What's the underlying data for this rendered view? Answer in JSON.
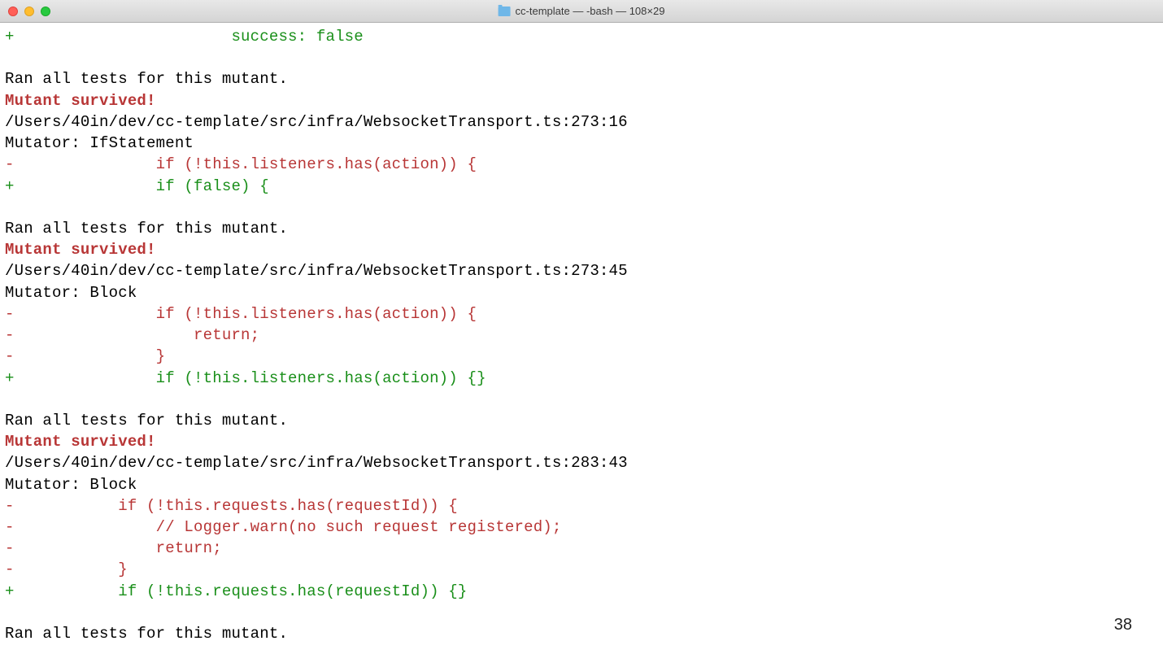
{
  "window": {
    "title": "cc-template — -bash — 108×29"
  },
  "terminal": {
    "lines": [
      {
        "cls": "diff-add",
        "text": "+                       success: false"
      },
      {
        "cls": "",
        "text": ""
      },
      {
        "cls": "",
        "text": "Ran all tests for this mutant."
      },
      {
        "cls": "survived",
        "text": "Mutant survived!"
      },
      {
        "cls": "",
        "text": "/Users/40in/dev/cc-template/src/infra/WebsocketTransport.ts:273:16"
      },
      {
        "cls": "",
        "text": "Mutator: IfStatement"
      },
      {
        "cls": "diff-del",
        "text": "-               if (!this.listeners.has(action)) {"
      },
      {
        "cls": "diff-add",
        "text": "+               if (false) {"
      },
      {
        "cls": "",
        "text": ""
      },
      {
        "cls": "",
        "text": "Ran all tests for this mutant."
      },
      {
        "cls": "survived",
        "text": "Mutant survived!"
      },
      {
        "cls": "",
        "text": "/Users/40in/dev/cc-template/src/infra/WebsocketTransport.ts:273:45"
      },
      {
        "cls": "",
        "text": "Mutator: Block"
      },
      {
        "cls": "diff-del",
        "text": "-               if (!this.listeners.has(action)) {"
      },
      {
        "cls": "diff-del",
        "text": "-                   return;"
      },
      {
        "cls": "diff-del",
        "text": "-               }"
      },
      {
        "cls": "diff-add",
        "text": "+               if (!this.listeners.has(action)) {}"
      },
      {
        "cls": "",
        "text": ""
      },
      {
        "cls": "",
        "text": "Ran all tests for this mutant."
      },
      {
        "cls": "survived",
        "text": "Mutant survived!"
      },
      {
        "cls": "",
        "text": "/Users/40in/dev/cc-template/src/infra/WebsocketTransport.ts:283:43"
      },
      {
        "cls": "",
        "text": "Mutator: Block"
      },
      {
        "cls": "diff-del",
        "text": "-           if (!this.requests.has(requestId)) {"
      },
      {
        "cls": "diff-del",
        "text": "-               // Logger.warn(no such request registered);"
      },
      {
        "cls": "diff-del",
        "text": "-               return;"
      },
      {
        "cls": "diff-del",
        "text": "-           }"
      },
      {
        "cls": "diff-add",
        "text": "+           if (!this.requests.has(requestId)) {}"
      },
      {
        "cls": "",
        "text": ""
      },
      {
        "cls": "",
        "text": "Ran all tests for this mutant."
      }
    ]
  },
  "page_number": "38"
}
